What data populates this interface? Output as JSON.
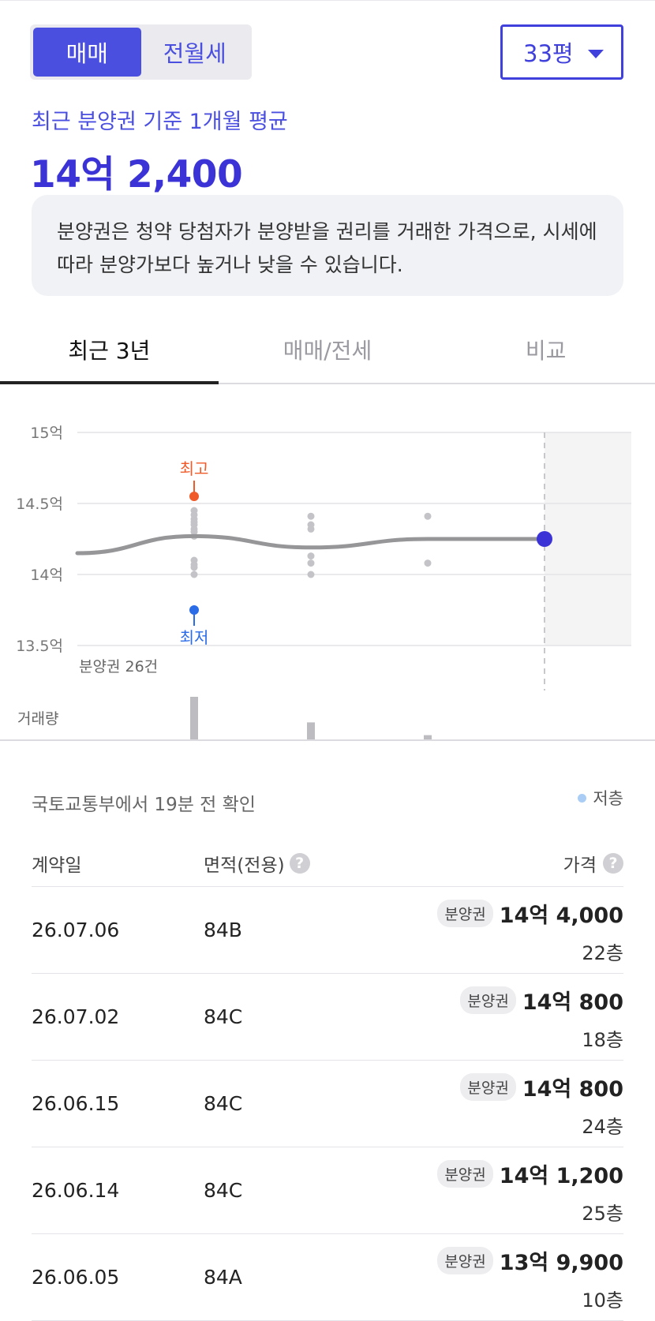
{
  "trade_toggle": {
    "sale": "매매",
    "rent": "전월세",
    "selected": "매매"
  },
  "size_selector": {
    "value": "33평"
  },
  "summary": {
    "label": "최근 분양권 기준 1개월 평균",
    "price": "14억 2,400",
    "notice": "분양권은 청약 당첨자가 분양받을 권리를 거래한 가격으로, 시세에 따라 분양가보다 높거나 낮을 수 있습니다."
  },
  "tabs": [
    {
      "label": "최근 3년",
      "active": true
    },
    {
      "label": "매매/전세",
      "active": false
    },
    {
      "label": "비교",
      "active": false
    }
  ],
  "chart_data": {
    "type": "scatter",
    "yticks": [
      "15억",
      "14.5억",
      "14억",
      "13.5억"
    ],
    "ylim": [
      13.5,
      15
    ],
    "trend_line": [
      {
        "x": 0.0,
        "y": 14.15
      },
      {
        "x": 0.25,
        "y": 14.27
      },
      {
        "x": 0.5,
        "y": 14.19
      },
      {
        "x": 0.75,
        "y": 14.25
      },
      {
        "x": 1.0,
        "y": 14.25
      }
    ],
    "points": [
      {
        "x": 0.25,
        "values": [
          14.45,
          14.42,
          14.39,
          14.37,
          14.35,
          14.32,
          14.3,
          14.27,
          14.1,
          14.07,
          14.05,
          14.0
        ]
      },
      {
        "x": 0.5,
        "values": [
          14.41,
          14.35,
          14.32,
          14.13,
          14.08,
          14.0
        ]
      },
      {
        "x": 0.75,
        "values": [
          14.41,
          14.08
        ]
      }
    ],
    "current": {
      "x": 1.0,
      "y": 14.25
    },
    "high": {
      "label": "최고",
      "x": 0.25,
      "y": 14.55,
      "color": "#f05a28"
    },
    "low": {
      "label": "최저",
      "x": 0.25,
      "y": 13.75,
      "color": "#2a6be8"
    },
    "count_label": "분양권 26건",
    "volume_label": "거래량",
    "volume": [
      {
        "x": 0.25,
        "value": 10
      },
      {
        "x": 0.5,
        "value": 4
      },
      {
        "x": 0.75,
        "value": 1
      }
    ]
  },
  "list": {
    "source": "국토교통부에서 19분 전 확인",
    "legend": "저층",
    "headers": {
      "date": "계약일",
      "area": "면적(전용)",
      "price": "가격"
    },
    "help_glyph": "?",
    "rows": [
      {
        "date": "26.07.06",
        "area": "84B",
        "badge": "분양권",
        "price": "14억 4,000",
        "floor": "22층"
      },
      {
        "date": "26.07.02",
        "area": "84C",
        "badge": "분양권",
        "price": "14억 800",
        "floor": "18층"
      },
      {
        "date": "26.06.15",
        "area": "84C",
        "badge": "분양권",
        "price": "14억 800",
        "floor": "24층"
      },
      {
        "date": "26.06.14",
        "area": "84C",
        "badge": "분양권",
        "price": "14억 1,200",
        "floor": "25층"
      },
      {
        "date": "26.06.05",
        "area": "84A",
        "badge": "분양권",
        "price": "13억 9,900",
        "floor": "10층"
      }
    ]
  }
}
